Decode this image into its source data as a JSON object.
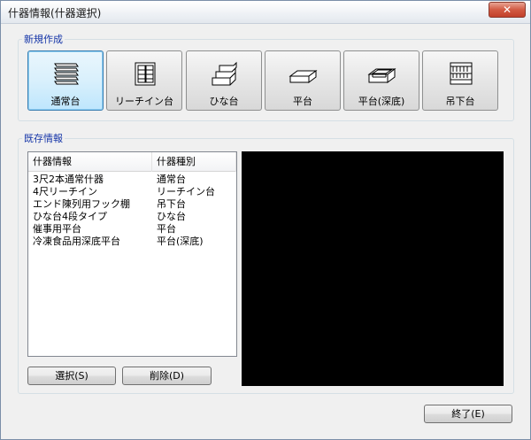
{
  "window": {
    "title": "什器情報(什器選択)",
    "close_symbol": "✕"
  },
  "new_section": {
    "label": "新規作成",
    "items": [
      {
        "label": "通常台",
        "icon": "stacked-shelves-icon",
        "active": true
      },
      {
        "label": "リーチイン台",
        "icon": "reach-in-cabinet-icon",
        "active": false
      },
      {
        "label": "ひな台",
        "icon": "tiered-stand-icon",
        "active": false
      },
      {
        "label": "平台",
        "icon": "flat-table-icon",
        "active": false
      },
      {
        "label": "平台(深底)",
        "icon": "deep-flat-table-icon",
        "active": false
      },
      {
        "label": "吊下台",
        "icon": "hanging-rack-icon",
        "active": false
      }
    ]
  },
  "existing_section": {
    "label": "既存情報",
    "columns": [
      "什器情報",
      "什器種別"
    ],
    "rows": [
      {
        "name": "3尺2本通常什器",
        "type": "通常台"
      },
      {
        "name": "4尺リーチイン",
        "type": "リーチイン台"
      },
      {
        "name": "エンド陳列用フック棚",
        "type": "吊下台"
      },
      {
        "name": "ひな台4段タイプ",
        "type": "ひな台"
      },
      {
        "name": "催事用平台",
        "type": "平台"
      },
      {
        "name": "冷凍食品用深底平台",
        "type": "平台(深底)"
      }
    ],
    "select_button": "選択(S)",
    "delete_button": "削除(D)"
  },
  "footer": {
    "exit_button": "終了(E)"
  }
}
